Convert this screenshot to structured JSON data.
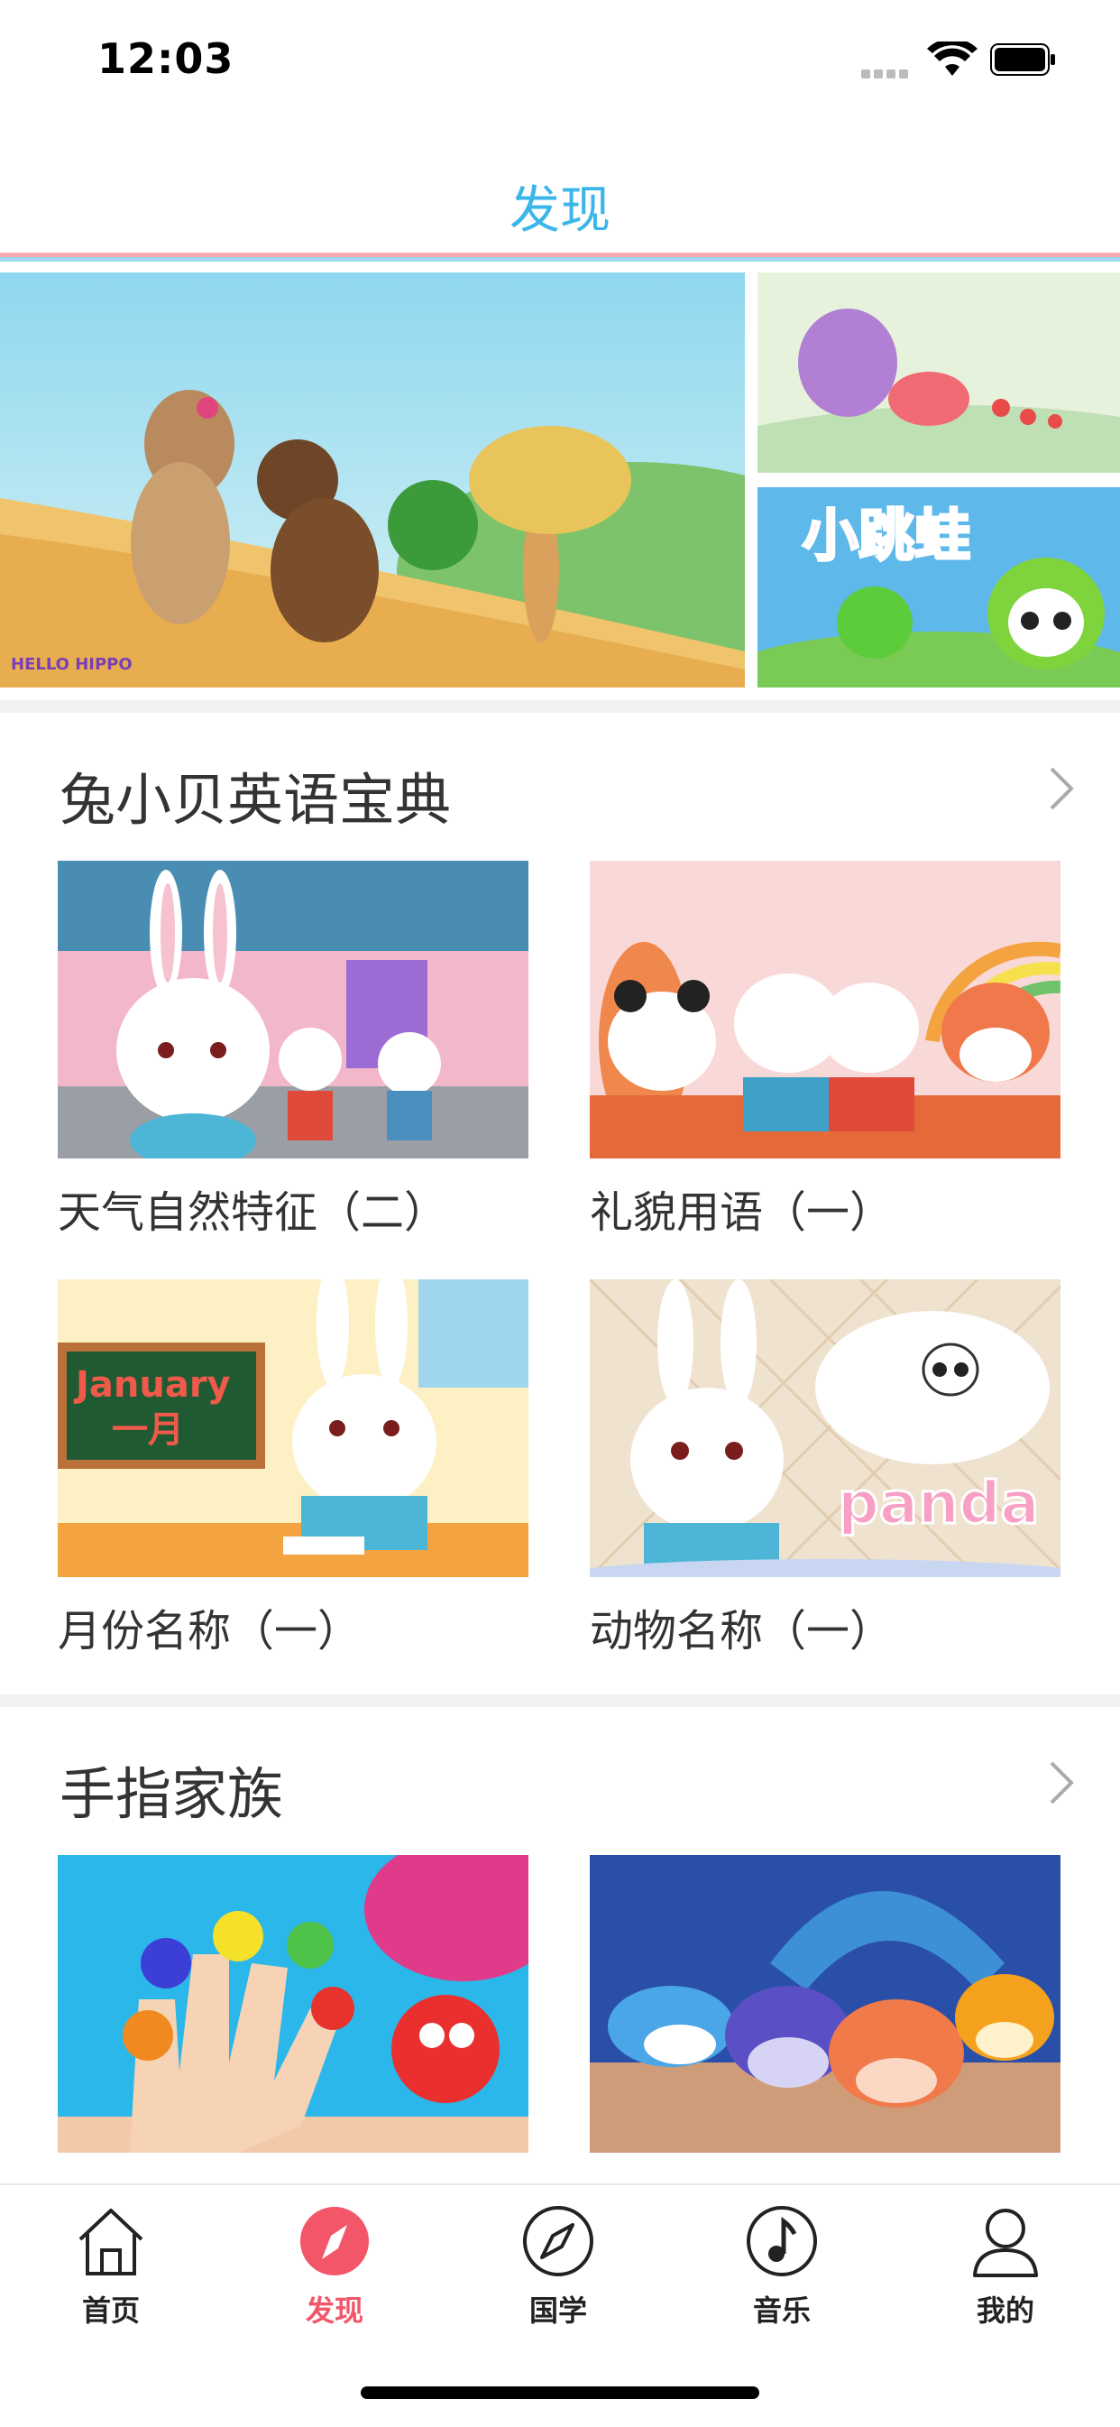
{
  "status_bar": {
    "time": "12:03"
  },
  "navbar": {
    "title": "发现"
  },
  "sections": [
    {
      "title": "兔小贝英语宝典",
      "items": [
        {
          "caption": "天气自然特征（二）"
        },
        {
          "caption": "礼貌用语（一）"
        },
        {
          "caption": "月份名称（一）"
        },
        {
          "caption": "动物名称（一）"
        }
      ]
    },
    {
      "title": "手指家族",
      "items": [
        {
          "caption": ""
        },
        {
          "caption": ""
        }
      ]
    }
  ],
  "banner": {
    "side2_text": "小跳蛙",
    "main_logo": "HELLO HIPPO"
  },
  "thumb_text": {
    "january": "January",
    "january_cn": "一月",
    "panda": "panda"
  },
  "tabbar": {
    "items": [
      {
        "label": "首页",
        "icon": "home-icon"
      },
      {
        "label": "发现",
        "icon": "compass-filled-icon",
        "active": true
      },
      {
        "label": "国学",
        "icon": "compass-icon"
      },
      {
        "label": "音乐",
        "icon": "music-note-icon"
      },
      {
        "label": "我的",
        "icon": "user-icon"
      }
    ],
    "active_color": "#f25668"
  },
  "colors": {
    "accent": "#3bb6e8",
    "active_tab": "#f25668"
  }
}
